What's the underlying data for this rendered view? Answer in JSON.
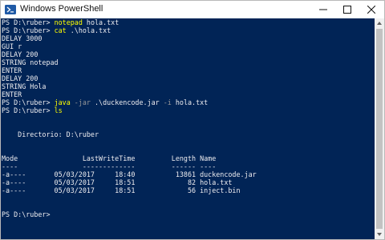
{
  "window": {
    "title": "Windows PowerShell",
    "icon": "powershell-icon",
    "controls": [
      "minimize-icon",
      "maximize-icon",
      "close-icon"
    ]
  },
  "colors": {
    "console_background": "#012456",
    "default_text": "#eeedf0",
    "command_text": "#ffff00",
    "argument_text": "#9a9a9a"
  },
  "console": {
    "lines": [
      [
        {
          "t": "PS D:\\ruber> ",
          "c": "default"
        },
        {
          "t": "notepad",
          "c": "cmd"
        },
        {
          "t": " hola.txt",
          "c": "default"
        }
      ],
      [
        {
          "t": "PS D:\\ruber> ",
          "c": "default"
        },
        {
          "t": "cat",
          "c": "cmd"
        },
        {
          "t": " .\\hola.txt",
          "c": "default"
        }
      ],
      [
        {
          "t": "DELAY 3000",
          "c": "default"
        }
      ],
      [
        {
          "t": "GUI r",
          "c": "default"
        }
      ],
      [
        {
          "t": "DELAY 200",
          "c": "default"
        }
      ],
      [
        {
          "t": "STRING notepad",
          "c": "default"
        }
      ],
      [
        {
          "t": "ENTER",
          "c": "default"
        }
      ],
      [
        {
          "t": "DELAY 200",
          "c": "default"
        }
      ],
      [
        {
          "t": "STRING Hola",
          "c": "default"
        }
      ],
      [
        {
          "t": "ENTER",
          "c": "default"
        }
      ],
      [
        {
          "t": "PS D:\\ruber> ",
          "c": "default"
        },
        {
          "t": "java",
          "c": "cmd"
        },
        {
          "t": " -jar",
          "c": "arg"
        },
        {
          "t": " .\\duckencode.jar",
          "c": "default"
        },
        {
          "t": " -i",
          "c": "arg"
        },
        {
          "t": " hola.txt",
          "c": "default"
        }
      ],
      [
        {
          "t": "PS D:\\ruber> ",
          "c": "default"
        },
        {
          "t": "ls",
          "c": "cmd"
        }
      ],
      [
        {
          "t": "",
          "c": "default"
        }
      ],
      [
        {
          "t": "",
          "c": "default"
        }
      ],
      [
        {
          "t": "    Directorio: D:\\ruber",
          "c": "default"
        }
      ],
      [
        {
          "t": "",
          "c": "default"
        }
      ],
      [
        {
          "t": "",
          "c": "default"
        }
      ],
      [
        {
          "t": "Mode                LastWriteTime         Length Name",
          "c": "default"
        }
      ],
      [
        {
          "t": "----                -------------         ------ ----",
          "c": "default"
        }
      ],
      [
        {
          "t": "-a----       05/03/2017     18:40          13861 duckencode.jar",
          "c": "default"
        }
      ],
      [
        {
          "t": "-a----       05/03/2017     18:51             82 hola.txt",
          "c": "default"
        }
      ],
      [
        {
          "t": "-a----       05/03/2017     18:51             56 inject.bin",
          "c": "default"
        }
      ],
      [
        {
          "t": "",
          "c": "default"
        }
      ],
      [
        {
          "t": "",
          "c": "default"
        }
      ],
      [
        {
          "t": "PS D:\\ruber>",
          "c": "default"
        }
      ]
    ]
  }
}
